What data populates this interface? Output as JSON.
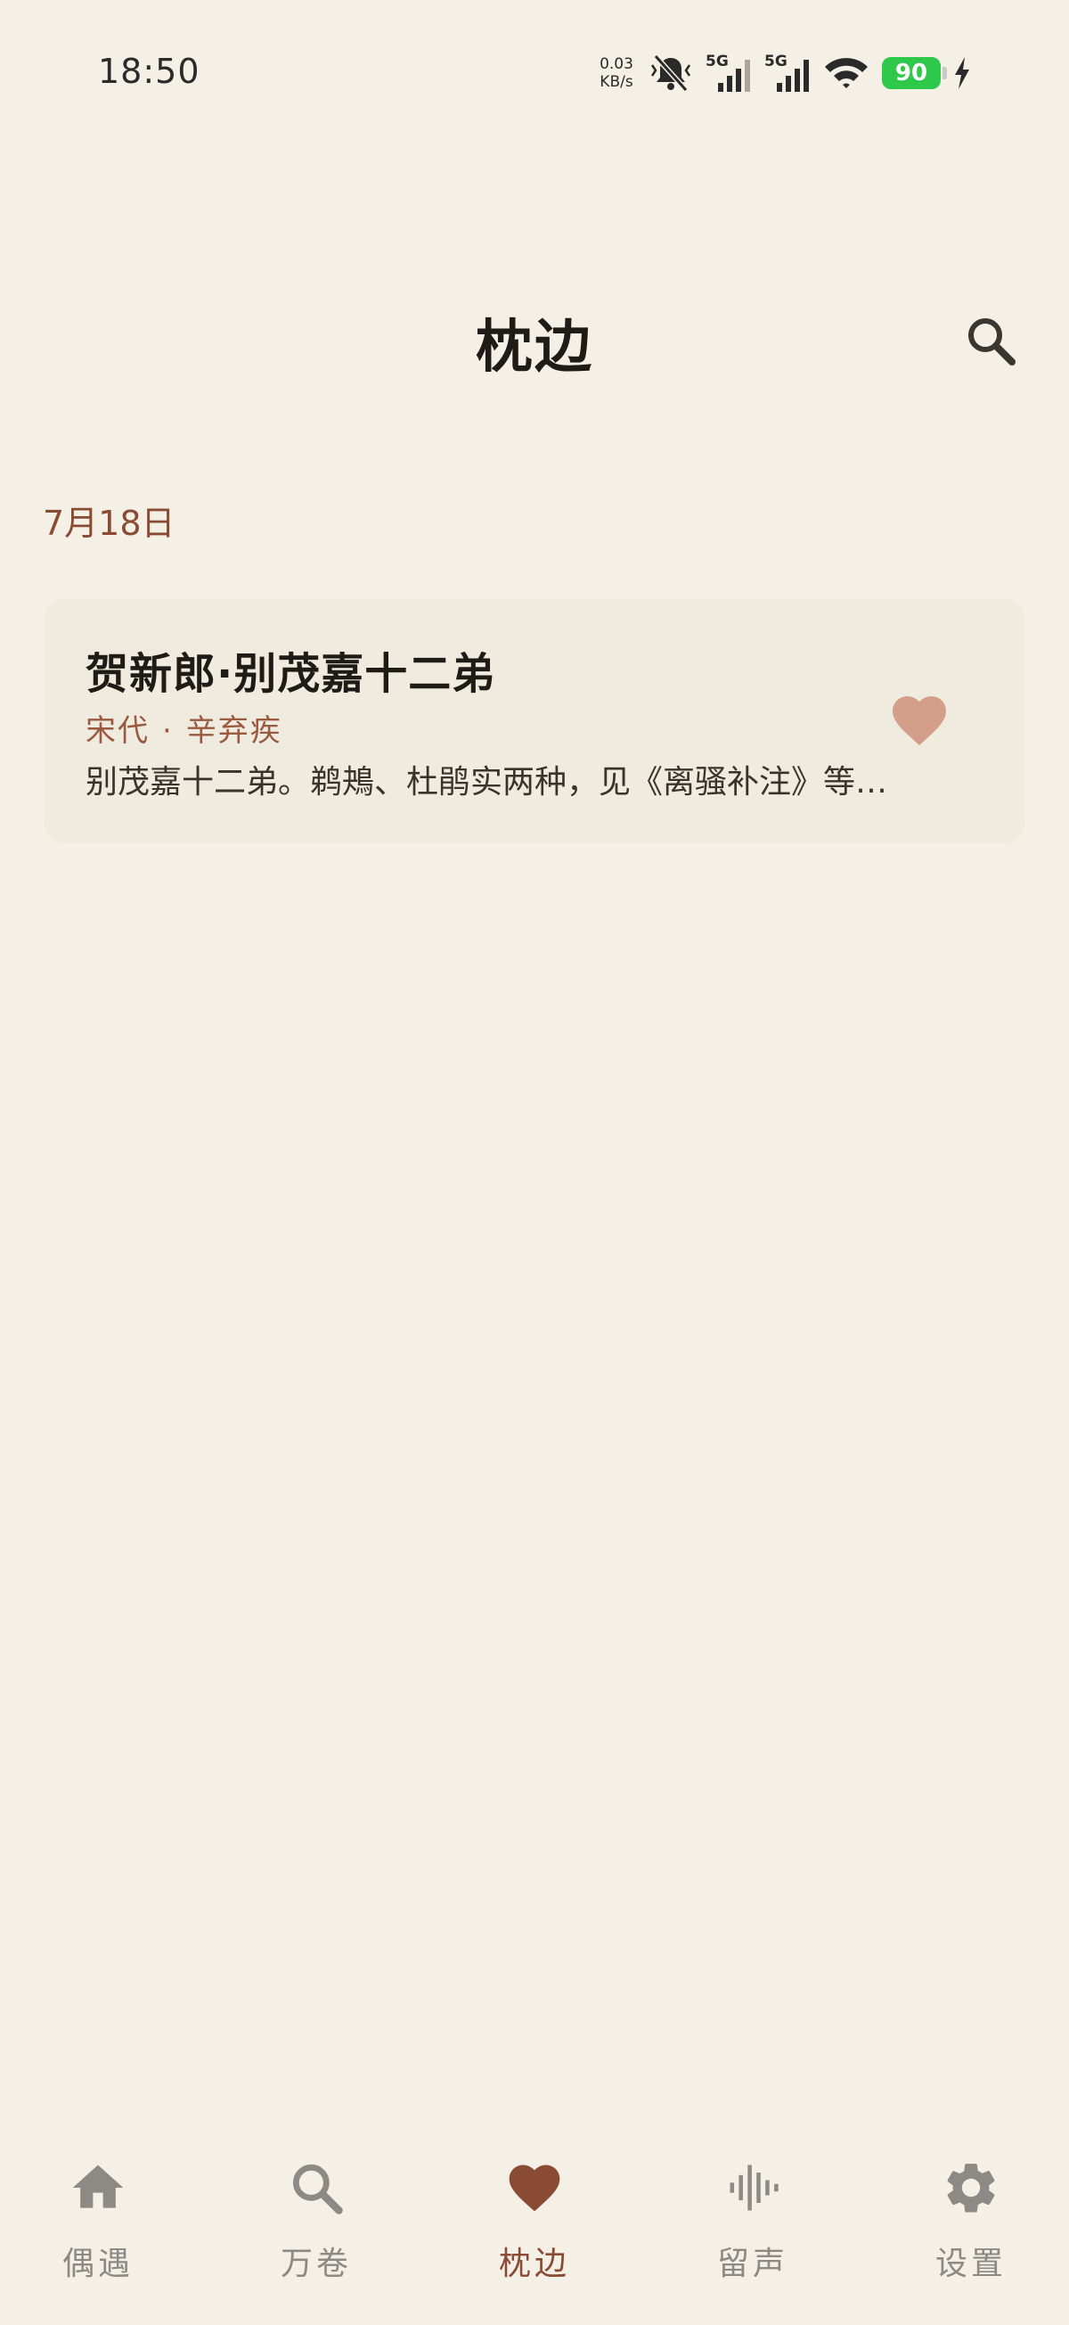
{
  "status_bar": {
    "time": "18:50",
    "net_speed_value": "0.03",
    "net_speed_unit": "KB/s",
    "sim1_tag": "5G",
    "sim2_tag": "5G",
    "battery_level": "90",
    "battery_color": "#2ec84a",
    "icons": [
      "mute-bell-icon",
      "signal-icon",
      "signal-icon",
      "wifi-icon",
      "battery-icon",
      "charging-icon"
    ]
  },
  "header": {
    "title": "枕边",
    "search_icon": "search-icon"
  },
  "groups": [
    {
      "date": "7月18日",
      "items": [
        {
          "title": "贺新郎·别茂嘉十二弟",
          "dynasty": "宋代",
          "separator": "·",
          "author": "辛弃疾",
          "excerpt": "别茂嘉十二弟。鹈鴂、杜鹃实两种，见《离骚补注》等书。",
          "favorited": true,
          "favorite_icon": "heart-icon"
        }
      ]
    }
  ],
  "bottom_nav": {
    "items": [
      {
        "label": "偶遇",
        "icon": "home-icon",
        "active": false
      },
      {
        "label": "万卷",
        "icon": "search-icon",
        "active": false
      },
      {
        "label": "枕边",
        "icon": "heart-icon",
        "active": true
      },
      {
        "label": "留声",
        "icon": "audio-wave-icon",
        "active": false
      },
      {
        "label": "设置",
        "icon": "gear-icon",
        "active": false
      }
    ]
  },
  "colors": {
    "background": "#f4f0e6",
    "accent": "#8a4b35",
    "card": "#f0ebdf",
    "favorite": "#d49f8a",
    "inactive_nav": "#8d8a85"
  }
}
